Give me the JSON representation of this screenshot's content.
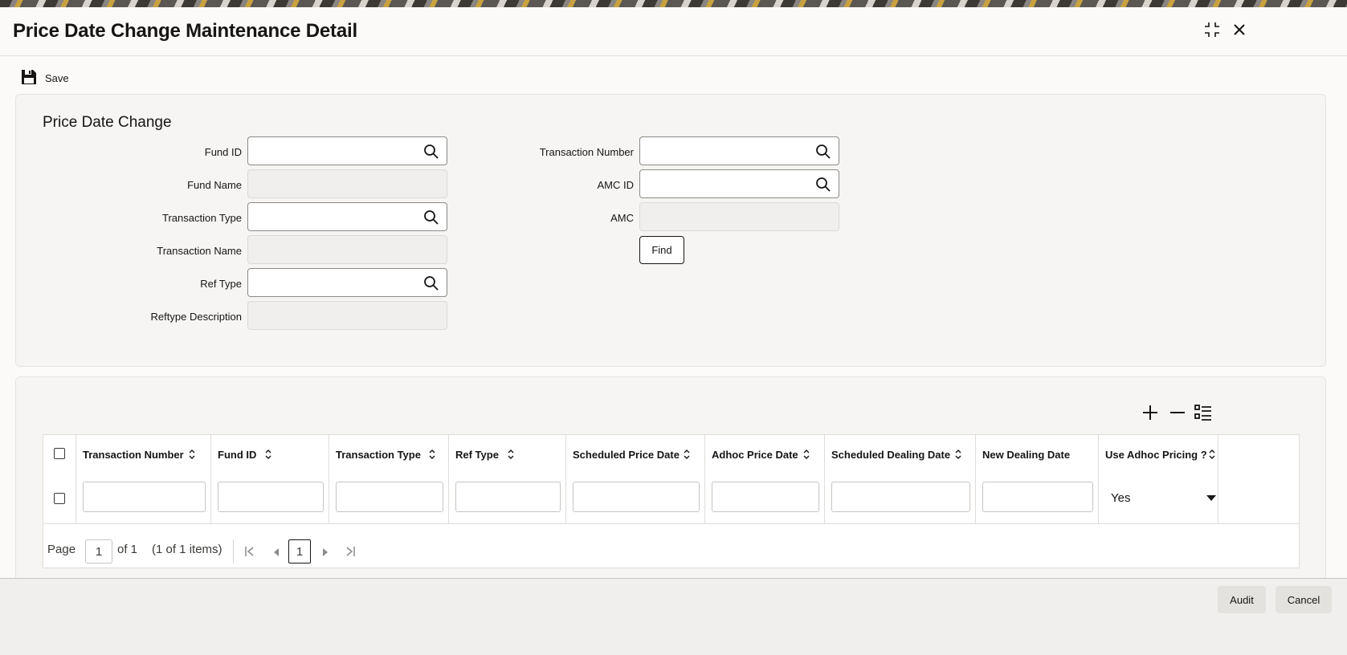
{
  "window": {
    "title": "Price Date Change Maintenance Detail"
  },
  "toolbar": {
    "save_label": "Save"
  },
  "form": {
    "section_title": "Price Date Change",
    "fund_id_label": "Fund ID",
    "fund_name_label": "Fund Name",
    "transaction_type_label": "Transaction Type",
    "transaction_name_label": "Transaction Name",
    "ref_type_label": "Ref Type",
    "reftype_description_label": "Reftype Description",
    "transaction_number_label": "Transaction Number",
    "amc_id_label": "AMC ID",
    "amc_label": "AMC",
    "find_label": "Find"
  },
  "table": {
    "columns": [
      "Transaction Number",
      "Fund ID",
      "Transaction Type",
      "Ref Type",
      "Scheduled Price Date",
      "Adhoc Price Date",
      "Scheduled Dealing Date",
      "New Dealing Date",
      "Use Adhoc Pricing ?"
    ],
    "row": {
      "use_adhoc_pricing": "Yes"
    }
  },
  "pager": {
    "page_label": "Page",
    "page_value": "1",
    "of_label": "of 1",
    "items_label": "(1 of 1 items)",
    "current_page": "1"
  },
  "footer": {
    "audit_label": "Audit",
    "cancel_label": "Cancel"
  }
}
